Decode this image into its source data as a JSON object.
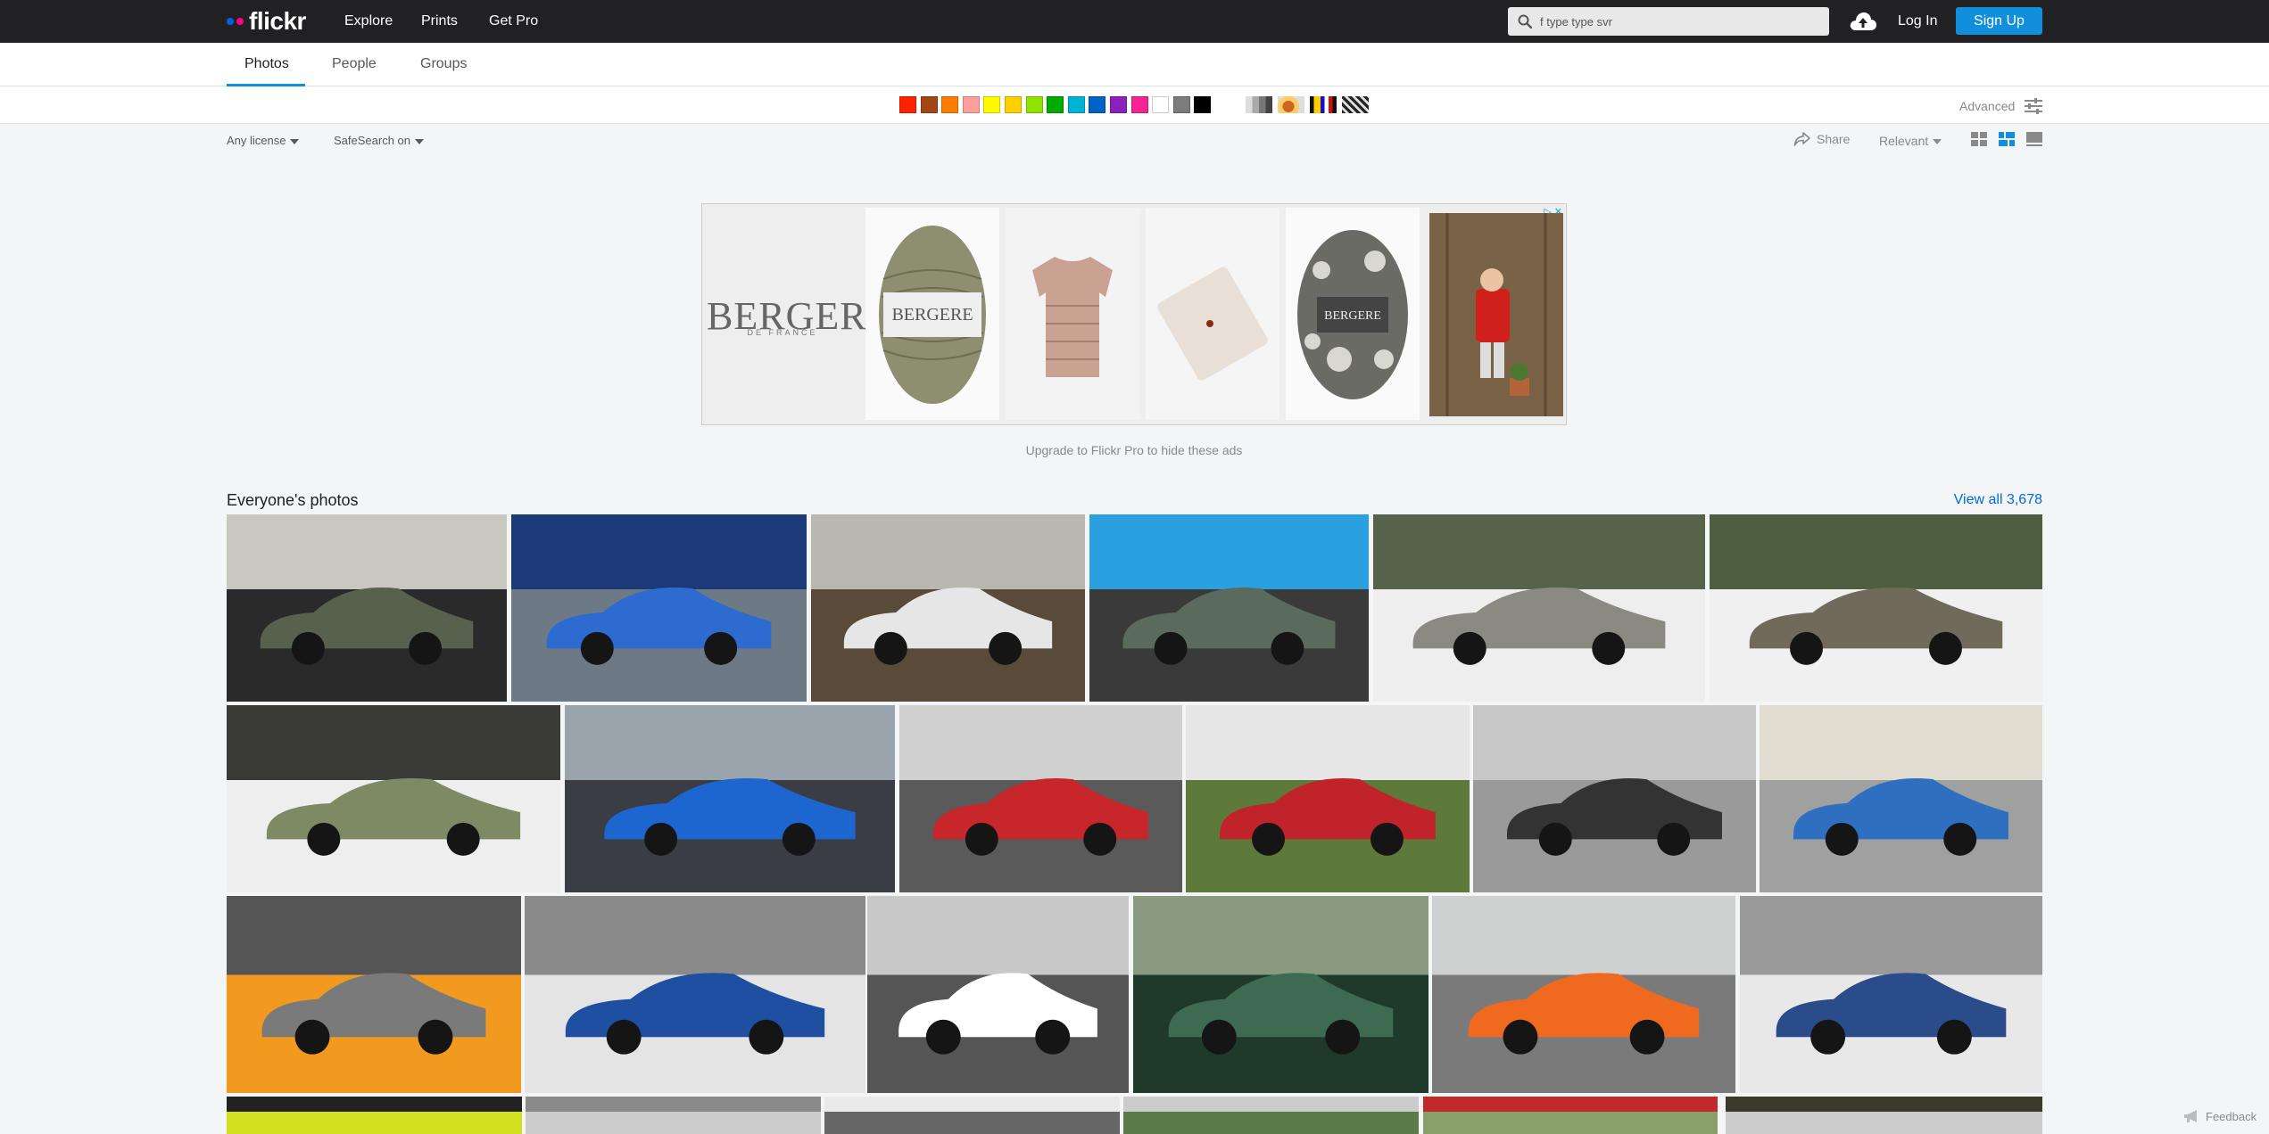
{
  "header": {
    "logo": "flickr",
    "nav": [
      "Explore",
      "Prints",
      "Get Pro"
    ],
    "search_value": "f type type svr",
    "login": "Log In",
    "signup": "Sign Up"
  },
  "tabs": [
    "Photos",
    "People",
    "Groups"
  ],
  "filters": {
    "colors": [
      "#ff2000",
      "#a24615",
      "#ff7c00",
      "#ff9f9c",
      "#fffa00",
      "#ffcf00",
      "#90e200",
      "#00ab00",
      "#00b2d4",
      "#0062c6",
      "#8c20ba",
      "#f52394",
      "#ffffff",
      "#7c7c7c",
      "#000000"
    ],
    "advanced": "Advanced",
    "license": "Any license",
    "safesearch": "SafeSearch on",
    "share": "Share",
    "sort": "Relevant"
  },
  "ad": {
    "brand": "BERGERE",
    "brand_sub": "DE FRANCE",
    "upgrade_text": "Upgrade to Flickr Pro to hide these ads"
  },
  "photos": {
    "title": "Everyone's photos",
    "view_all": "View all 3,678"
  },
  "feedback": "Feedback"
}
